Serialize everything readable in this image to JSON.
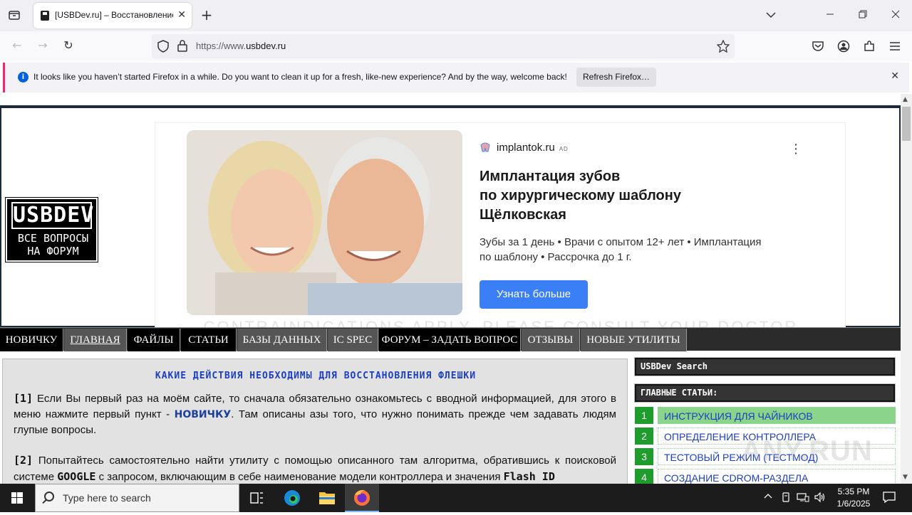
{
  "browser": {
    "tab_title": "[USBDev.ru] – Восстановление",
    "url_prefix": "https://www.",
    "url_domain": "usbdev.ru",
    "notification": "It looks like you haven’t started Firefox in a while. Do you want to clean it up for a fresh, like-new experience? And by the way, welcome back!",
    "notification_button": "Refresh Firefox…"
  },
  "site": {
    "logo_line1": "USBDEV",
    "logo_line2": "ВСЕ ВОПРОСЫ",
    "logo_line3": "НА ФОРУМ"
  },
  "ad": {
    "sponsor": "implantok.ru",
    "ad_tag": "AD",
    "title_line1": "Имплантация зубов",
    "title_line2": "по хирургическому шаблону",
    "title_line3": "Щёлковская",
    "desc_line1": "Зубы за 1 день • Врачи с опытом 12+ лет • Имплантация",
    "desc_line2": "по шаблону • Рассрочка до 1 г.",
    "cta": "Узнать больше",
    "disclaimer": "CONTRAINDICATIONS APPLY. PLEASE CONSULT YOUR DOCTOR"
  },
  "menu": [
    "НОВИЧКУ",
    "ГЛАВНАЯ",
    "ФАЙЛЫ",
    "СТАТЬИ",
    "БАЗЫ ДАННЫХ",
    "IC SPEC",
    "ФОРУМ – ЗАДАТЬ ВОПРОС",
    "ОТЗЫВЫ",
    "НОВЫЕ УТИЛИТЫ"
  ],
  "article": {
    "heading": "КАКИЕ ДЕЙСТВИЯ НЕОБХОДИМЫ ДЛЯ ВОССТАНОВЛЕНИЯ ФЛЕШКИ",
    "p1_num": "[1]",
    "p1_a": " Если Вы первый раз на моём сайте, то сначала обязательно ознакомьтесь с вводной информацией, для этого в меню нажмите первый пункт - ",
    "p1_link": "НОВИЧКУ",
    "p1_b": ". Там описаны азы того, что нужно понимать прежде чем задавать людям глупые вопросы.",
    "p2_num": "[2]",
    "p2_a": " Попытайтесь самостоятельно найти утилиту с помощью описанного там алгоритма, обратившись к поисковой системе ",
    "p2_google": "GOOGLE",
    "p2_b": " с запросом, включающим в себе наименование модели контроллера и значения ",
    "p2_flash": "Flash ID"
  },
  "sidebar": {
    "search_title": "USBDev Search",
    "main_title": "ГЛАВНЫЕ СТАТЬИ:",
    "items": [
      {
        "num": "1",
        "label": "ИНСТРУКЦИЯ ДЛЯ ЧАЙНИКОВ"
      },
      {
        "num": "2",
        "label": "ОПРЕДЕЛЕНИЕ КОНТРОЛЛЕРА"
      },
      {
        "num": "3",
        "label": "ТЕСТОВЫЙ РЕЖИМ (ТЕСТМОД)"
      },
      {
        "num": "4",
        "label": "СОЗДАНИЕ CDROM-РАЗДЕЛА"
      }
    ]
  },
  "taskbar": {
    "search_placeholder": "Type here to search",
    "time": "5:35 PM",
    "date": "1/6/2025"
  },
  "watermark": "ANY.RUN"
}
